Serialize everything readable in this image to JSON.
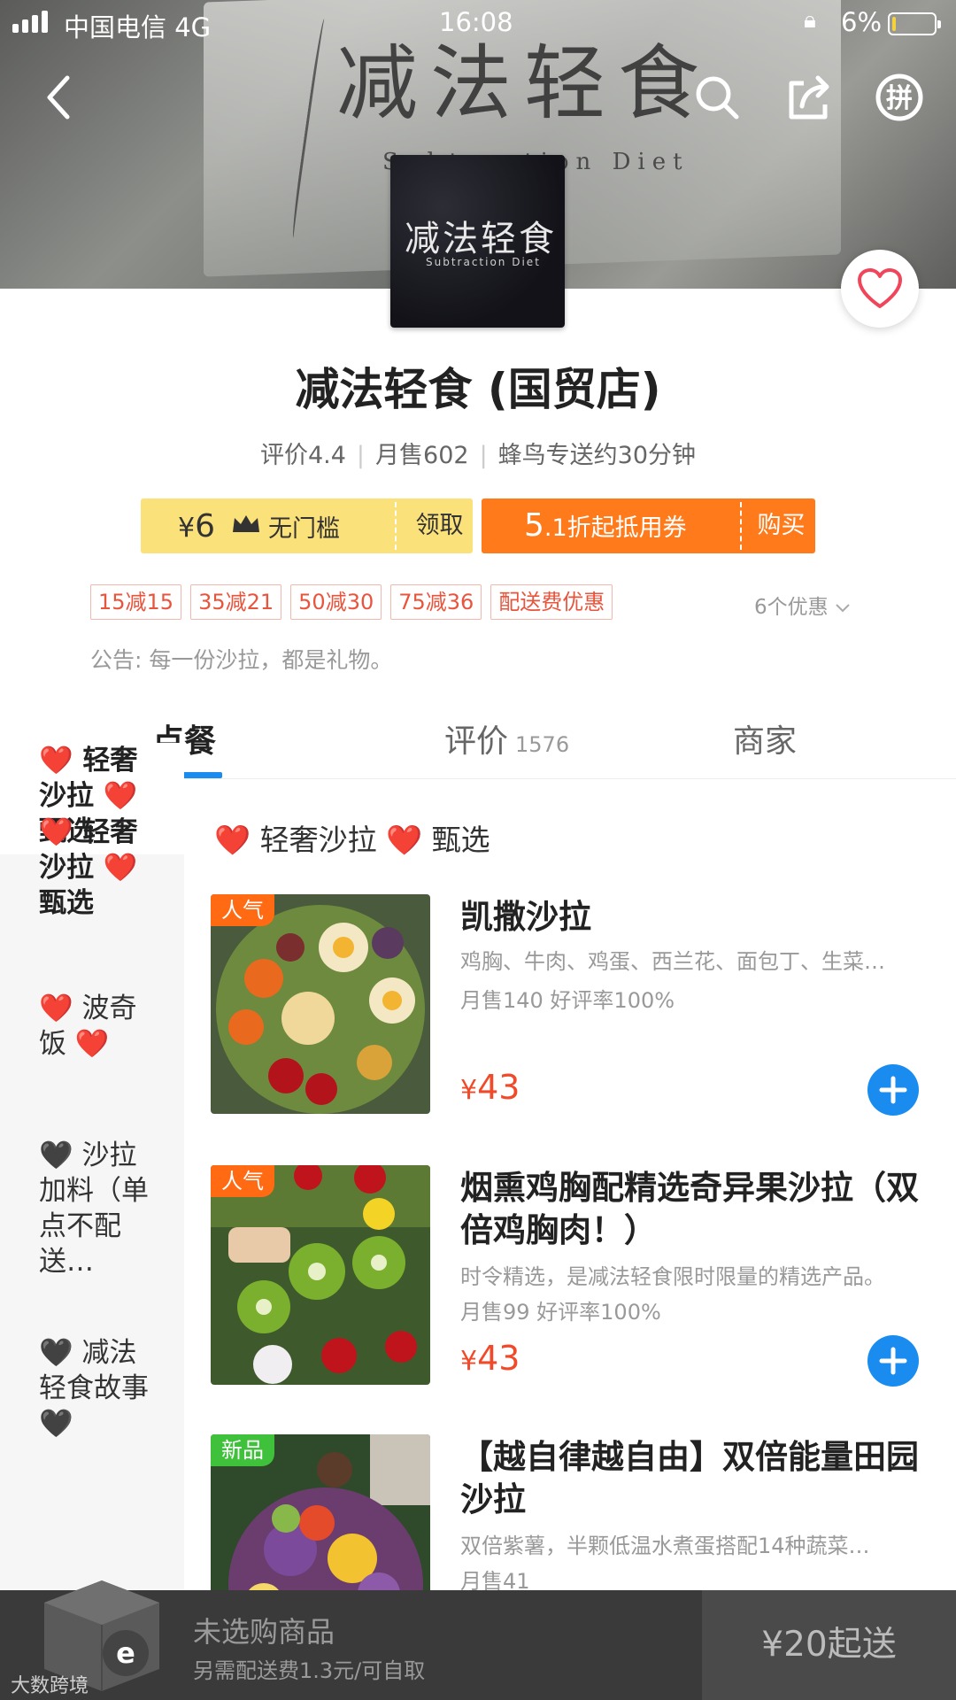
{
  "status_bar": {
    "carrier": "中国电信 4G",
    "time": "16:08",
    "battery": "6%"
  },
  "banner": {
    "sign_text": "减法轻食",
    "sign_sub": "Subtraction Diet"
  },
  "logo": {
    "text": "减法轻食",
    "sub": "Subtraction Diet"
  },
  "shop": {
    "name": "减法轻食 (国贸店)",
    "rating": "评价4.4",
    "monthly_sales": "月售602",
    "delivery": "蜂鸟专送约30分钟"
  },
  "coupons": {
    "c1_symbol": "¥",
    "c1_amount": "6",
    "c1_condition": "无门槛",
    "c1_action": "领取",
    "c2_num": "5",
    "c2_dec": ".1",
    "c2_text": "折起抵用券",
    "c2_action": "购买"
  },
  "promotions": [
    "15减15",
    "35减21",
    "50减30",
    "75减36",
    "配送费优惠"
  ],
  "promotions_more": "6个优惠",
  "notice": "公告: 每一份沙拉，都是礼物。",
  "tabs": {
    "order": "点餐",
    "review": "评价",
    "review_count": "1576",
    "merchant": "商家"
  },
  "sidebar": [
    {
      "label": "❤️ 轻奢沙拉 ❤️ 甄选"
    },
    {
      "label": "❤️ 波奇饭 ❤️"
    },
    {
      "label": "🖤 沙拉加料（单点不配送…"
    },
    {
      "label": "🖤 减法轻食故事 🖤"
    }
  ],
  "category_title": "❤️ 轻奢沙拉 ❤️ 甄选",
  "dishes": [
    {
      "tag": "人气",
      "name": "凯撒沙拉",
      "desc": "鸡胸、牛肉、鸡蛋、西兰花、面包丁、生菜…",
      "sales": "月售140  好评率100%",
      "price_symbol": "¥",
      "price": "43"
    },
    {
      "tag": "人气",
      "name": "烟熏鸡胸配精选奇异果沙拉（双倍鸡胸肉！）",
      "desc": "时令精选，是减法轻食限时限量的精选产品。",
      "sales": "月售99  好评率100%",
      "price_symbol": "¥",
      "price": "43"
    },
    {
      "tag": "新品",
      "name": "【越自律越自由】双倍能量田园沙拉",
      "desc": "双倍紫薯，半颗低温水煮蛋搭配14种蔬菜…",
      "sales": "月售41"
    }
  ],
  "cart": {
    "empty_text": "未选购商品",
    "fee_text": "另需配送费1.3元/可自取",
    "min_order": "¥20起送"
  },
  "watermark": "大数跨境",
  "colors": {
    "primary_blue": "#1a8cf0",
    "price_red": "#f04a2a",
    "coupon_yellow": "#fbe17a",
    "coupon_orange": "#ff7a1a"
  }
}
